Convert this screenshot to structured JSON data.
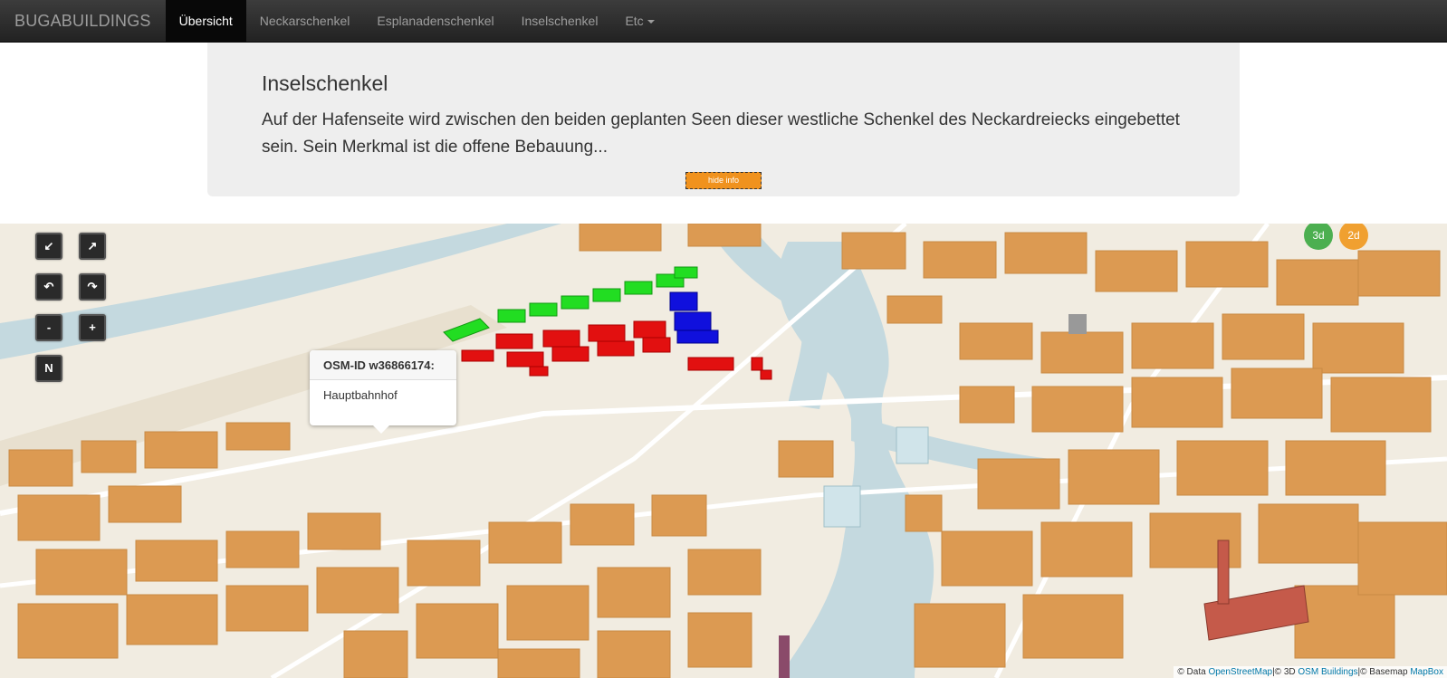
{
  "navbar": {
    "brand": "BUGABUILDINGS",
    "items": [
      {
        "label": "Übersicht"
      },
      {
        "label": "Neckarschenkel"
      },
      {
        "label": "Esplanadenschenkel"
      },
      {
        "label": "Inselschenkel"
      },
      {
        "label": "Etc"
      }
    ]
  },
  "info": {
    "title": "Inselschenkel",
    "text": "Auf der Hafenseite wird zwischen den beiden geplanten Seen dieser westliche Schenkel des Neckardreiecks eingebettet sein. Sein Merkmal ist die offene Bebauung...",
    "hide_button": "hide info"
  },
  "controls": {
    "tilt_down": "↙",
    "tilt_up": "↗",
    "rotate_left": "↶",
    "rotate_right": "↷",
    "zoom_out": "-",
    "zoom_in": "+",
    "north": "N",
    "mode_3d": "3d",
    "mode_2d": "2d"
  },
  "popup": {
    "title": "OSM-ID w36866174:",
    "body": "Hauptbahnhof"
  },
  "attribution": {
    "prefix": "© Data ",
    "osm": "OpenStreetMap",
    "mid": "|© 3D ",
    "osmb": "OSM Buildings",
    "suffix": "|© Basemap ",
    "mapbox": "MapBox"
  },
  "colors": {
    "building": "#e0a05a",
    "highlight_green": "#22dd22",
    "highlight_red": "#e21010",
    "highlight_blue": "#1010dd",
    "water": "#c4d9df",
    "mode_3d": "#4caf50",
    "mode_2d": "#f0a030"
  }
}
